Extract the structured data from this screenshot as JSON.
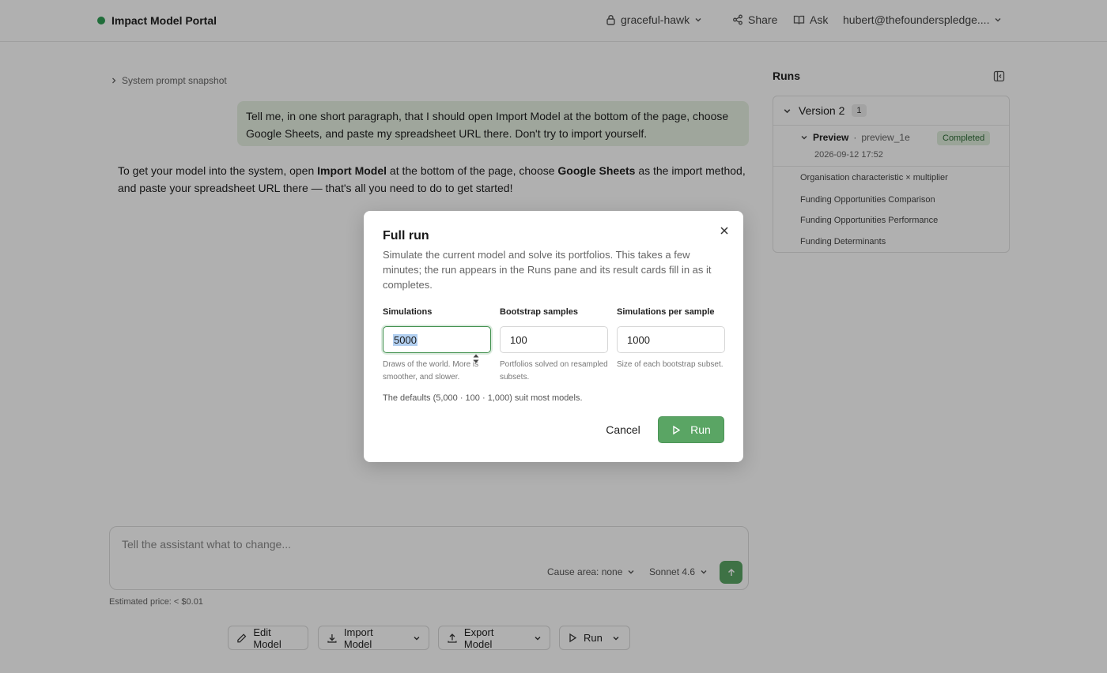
{
  "header": {
    "brand": "Impact Model Portal",
    "workspace": "graceful-hawk",
    "share_label": "Share",
    "ask_label": "Ask",
    "user_email": "hubert@thefounderspledge...."
  },
  "chat": {
    "system_prompt_label": "System prompt snapshot",
    "user_message": "Tell me, in one short paragraph, that I should open Import Model at the bottom of the page, choose Google Sheets, and paste my spreadsheet URL there. Don't try to import yourself.",
    "assistant_message": {
      "part1": "To get your model into the system, open ",
      "bold1": "Import Model",
      "part2": " at the bottom of the page, choose ",
      "bold2": "Google Sheets",
      "part3": " as the import method, and paste your spreadsheet URL there — that's all you need to do to get started!"
    }
  },
  "composer": {
    "placeholder": "Tell the assistant what to change...",
    "cause_area": "Cause area: none",
    "model": "Sonnet 4.6",
    "estimated_price": "Estimated price: < $0.01"
  },
  "toolbar": {
    "edit_model": "Edit Model",
    "import_model": "Import Model",
    "export_model": "Export Model",
    "run": "Run"
  },
  "runs": {
    "title": "Runs",
    "version_label": "Version 2",
    "version_count": "1",
    "preview_name": "Preview",
    "preview_sep": "·",
    "preview_id": "preview_1e",
    "preview_date": "2026-09-12 17:52",
    "status": "Completed",
    "cards": [
      "Organisation characteristic × multiplier",
      "Funding Opportunities Comparison",
      "Funding Opportunities Performance",
      "Funding Determinants"
    ]
  },
  "modal": {
    "title": "Full run",
    "description": "Simulate the current model and solve its portfolios. This takes a few minutes; the run appears in the Runs pane and its result cards fill in as it completes.",
    "fields": [
      {
        "label": "Simulations",
        "value": "5000",
        "help": "Draws of the world. More is smoother, and slower."
      },
      {
        "label": "Bootstrap samples",
        "value": "100",
        "help": "Portfolios solved on resampled subsets."
      },
      {
        "label": "Simulations per sample",
        "value": "1000",
        "help": "Size of each bootstrap subset."
      }
    ],
    "defaults_note": "The defaults (5,000 · 100 · 1,000) suit most models.",
    "cancel_label": "Cancel",
    "run_label": "Run"
  },
  "colors": {
    "accent_green": "#5aa564",
    "status_badge_bg": "#dfeedd",
    "user_bubble_bg": "#e7f1e3"
  }
}
